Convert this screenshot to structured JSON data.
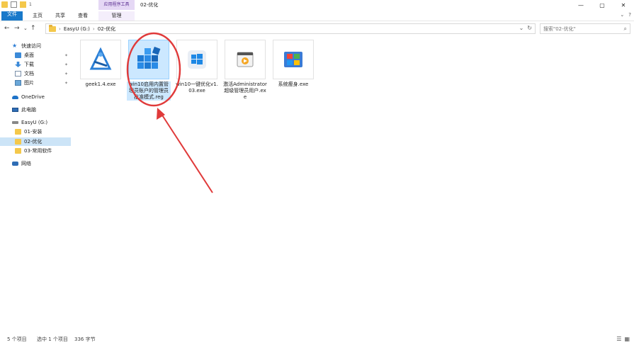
{
  "window": {
    "title": "02-优化",
    "context_tab": "应用程序工具",
    "quick_access_marker": "1"
  },
  "ribbon": {
    "tabs": [
      "文件",
      "主页",
      "共享",
      "查看",
      "管理"
    ]
  },
  "address": {
    "crumbs": [
      "EasyU (G:)",
      "02-优化"
    ],
    "search_placeholder": "搜索\"02-优化\""
  },
  "sidebar": {
    "items": [
      {
        "label": "快速访问",
        "icon": "star-icon"
      },
      {
        "label": "桌面",
        "icon": "desktop-icon",
        "pinned": true
      },
      {
        "label": "下载",
        "icon": "download-icon",
        "pinned": true
      },
      {
        "label": "文档",
        "icon": "document-icon",
        "pinned": true
      },
      {
        "label": "图片",
        "icon": "picture-icon",
        "pinned": true
      },
      {
        "label": "OneDrive",
        "icon": "cloud-icon"
      },
      {
        "label": "此电脑",
        "icon": "pc-icon"
      },
      {
        "label": "EasyU (G:)",
        "icon": "drive-icon"
      },
      {
        "label": "01-安装",
        "icon": "folder-icon"
      },
      {
        "label": "02-优化",
        "icon": "folder-icon",
        "selected": true
      },
      {
        "label": "03-常用软件",
        "icon": "folder-icon"
      },
      {
        "label": "网络",
        "icon": "network-icon"
      }
    ]
  },
  "files": [
    {
      "name": "geek1.4.exe",
      "icon": "geek-uninstaller-icon"
    },
    {
      "name": "win10启用内置管理员账户的管理员批准模式.reg",
      "icon": "registry-icon",
      "selected": true
    },
    {
      "name": "win10一键优化v1.03.exe",
      "icon": "windows-logo-icon"
    },
    {
      "name": "激活Administrator超级管理员用户.exe",
      "icon": "media-app-icon"
    },
    {
      "name": "系统瘦身.exe",
      "icon": "windows-flag-icon"
    }
  ],
  "status": {
    "count": "5 个项目",
    "selected": "选中 1 个项目",
    "size": "336 字节"
  },
  "colors": {
    "accent": "#1979ca",
    "selection": "#cce8ff",
    "annotation": "#e03a3a"
  }
}
